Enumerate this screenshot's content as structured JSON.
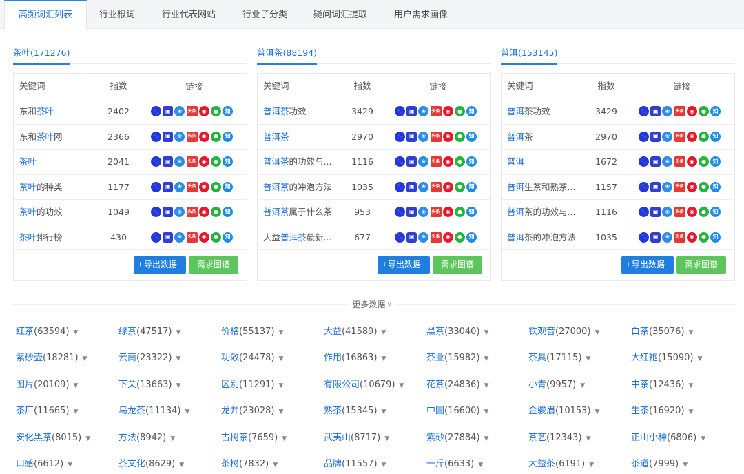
{
  "tabs": [
    {
      "label": "高频词汇列表",
      "active": true
    },
    {
      "label": "行业根词"
    },
    {
      "label": "行业代表网站"
    },
    {
      "label": "行业子分类"
    },
    {
      "label": "疑问词汇提取"
    },
    {
      "label": "用户需求画像"
    }
  ],
  "table_headers": {
    "keyword": "关键词",
    "index": "指数",
    "link": "链接"
  },
  "icon_names": [
    "baidu-icon",
    "mobile-baidu-icon",
    "360-icon",
    "toutiao-icon",
    "weibo-icon",
    "wechat-icon",
    "zhihu-icon"
  ],
  "buttons": {
    "export": "导出数据",
    "graph": "需求图谱"
  },
  "panels": [
    {
      "title": "茶叶(171276)",
      "rows": [
        {
          "pre": "东和",
          "hl": "茶叶",
          "post": "",
          "index": "2402"
        },
        {
          "pre": "东和",
          "hl": "茶叶",
          "post": "网",
          "index": "2366"
        },
        {
          "pre": "",
          "hl": "茶叶",
          "post": "",
          "index": "2041"
        },
        {
          "pre": "",
          "hl": "茶叶",
          "post": "的种类",
          "index": "1177"
        },
        {
          "pre": "",
          "hl": "茶叶",
          "post": "的功效",
          "index": "1049"
        },
        {
          "pre": "",
          "hl": "茶叶",
          "post": "排行榜",
          "index": "430"
        }
      ]
    },
    {
      "title": "普洱茶(88194)",
      "rows": [
        {
          "pre": "",
          "hl": "普洱茶",
          "post": "功效",
          "index": "3429"
        },
        {
          "pre": "",
          "hl": "普洱茶",
          "post": "",
          "index": "2970"
        },
        {
          "pre": "",
          "hl": "普洱茶",
          "post": "的功效与...",
          "index": "1116"
        },
        {
          "pre": "",
          "hl": "普洱茶",
          "post": "的冲泡方法",
          "index": "1035"
        },
        {
          "pre": "",
          "hl": "普洱茶",
          "post": "属于什么茶",
          "index": "953"
        },
        {
          "pre": "大益",
          "hl": "普洱茶",
          "post": "最新...",
          "index": "677"
        }
      ]
    },
    {
      "title": "普洱(153145)",
      "rows": [
        {
          "pre": "",
          "hl": "普洱",
          "post": "茶功效",
          "index": "3429"
        },
        {
          "pre": "",
          "hl": "普洱",
          "post": "茶",
          "index": "2970"
        },
        {
          "pre": "",
          "hl": "普洱",
          "post": "",
          "index": "1672"
        },
        {
          "pre": "",
          "hl": "普洱",
          "post": "生茶和熟茶...",
          "index": "1157"
        },
        {
          "pre": "",
          "hl": "普洱",
          "post": "茶的功效与...",
          "index": "1116"
        },
        {
          "pre": "",
          "hl": "普洱",
          "post": "茶的冲泡方法",
          "index": "1035"
        }
      ]
    }
  ],
  "more_label": "更多数据",
  "tag_rows": [
    [
      [
        "红茶",
        "(63594)"
      ],
      [
        "绿茶",
        "(47517)"
      ],
      [
        "价格",
        "(55137)"
      ],
      [
        "大益",
        "(41589)"
      ],
      [
        "黑茶",
        "(33040)"
      ],
      [
        "铁观音",
        "(27000)"
      ],
      [
        "白茶",
        "(35076)"
      ]
    ],
    [
      [
        "紫砂壶",
        "(18281)"
      ],
      [
        "云南",
        "(23322)"
      ],
      [
        "功效",
        "(24478)"
      ],
      [
        "作用",
        "(16863)"
      ],
      [
        "茶业",
        "(15982)"
      ],
      [
        "茶具",
        "(17115)"
      ],
      [
        "大红袍",
        "(15090)"
      ]
    ],
    [
      [
        "图片",
        "(20109)"
      ],
      [
        "下关",
        "(13663)"
      ],
      [
        "区别",
        "(11291)"
      ],
      [
        "有限公司",
        "(10679)"
      ],
      [
        "花茶",
        "(24836)"
      ],
      [
        "小青",
        "(9957)"
      ],
      [
        "中茶",
        "(12436)"
      ]
    ],
    [
      [
        "茶厂",
        "(11665)"
      ],
      [
        "乌龙茶",
        "(11134)"
      ],
      [
        "龙井",
        "(23028)"
      ],
      [
        "熟茶",
        "(15345)"
      ],
      [
        "中国",
        "(16600)"
      ],
      [
        "金骏眉",
        "(10153)"
      ],
      [
        "生茶",
        "(16920)"
      ]
    ],
    [
      [
        "安化黑茶",
        "(8015)"
      ],
      [
        "方法",
        "(8942)"
      ],
      [
        "古树茶",
        "(7659)"
      ],
      [
        "武夷山",
        "(8717)"
      ],
      [
        "紫砂",
        "(27884)"
      ],
      [
        "茶艺",
        "(12343)"
      ],
      [
        "正山小种",
        "(6806)"
      ]
    ],
    [
      [
        "口感",
        "(6612)"
      ],
      [
        "茶文化",
        "(8629)"
      ],
      [
        "茶树",
        "(7832)"
      ],
      [
        "品牌",
        "(11557)"
      ],
      [
        "一斤",
        "(6633)"
      ],
      [
        "大益茶",
        "(6191)"
      ],
      [
        "茶道",
        "(7999)"
      ]
    ]
  ],
  "colors": {
    "link": "#1e6fd9",
    "export_button": "#1e7fe0",
    "graph_button": "#5cc65c"
  }
}
